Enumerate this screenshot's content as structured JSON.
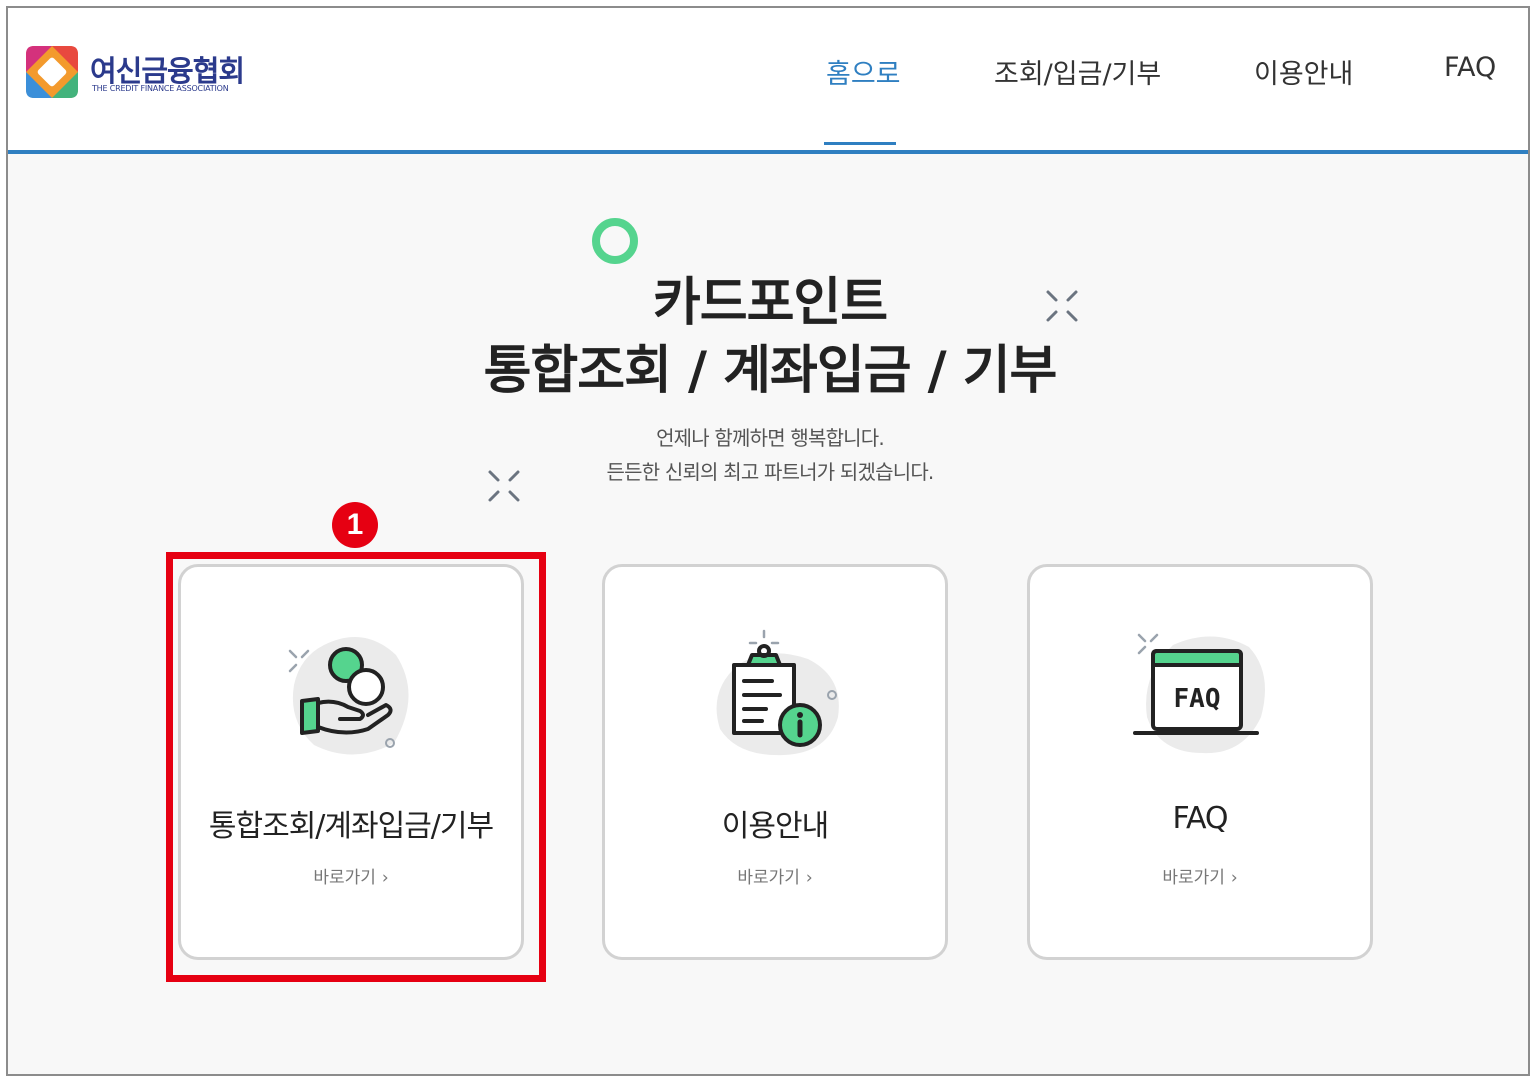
{
  "header": {
    "logo": {
      "name": "여신금융협회",
      "subtitle": "THE CREDIT FINANCE ASSOCIATION"
    },
    "nav": [
      {
        "label": "홈으로",
        "active": true
      },
      {
        "label": "조회/입금/기부",
        "active": false
      },
      {
        "label": "이용안내",
        "active": false
      },
      {
        "label": "FAQ",
        "active": false
      }
    ]
  },
  "hero": {
    "title_line1": "카드포인트",
    "title_line2": "통합조회 / 계좌입금 / 기부",
    "subtitle_line1": "언제나 함께하면 행복합니다.",
    "subtitle_line2": "든든한 신뢰의 최고 파트너가 되겠습니다."
  },
  "cards": [
    {
      "label": "통합조회/계좌입금/기부",
      "link": "바로가기",
      "icon": "coin-hand-icon"
    },
    {
      "label": "이용안내",
      "link": "바로가기",
      "icon": "clipboard-info-icon"
    },
    {
      "label": "FAQ",
      "link": "바로가기",
      "icon": "faq-screen-icon"
    }
  ],
  "annotation": {
    "number": "1",
    "color": "#e60012"
  },
  "colors": {
    "accent": "#2f7fc1",
    "green": "#55d48e",
    "highlight": "#e60012"
  }
}
